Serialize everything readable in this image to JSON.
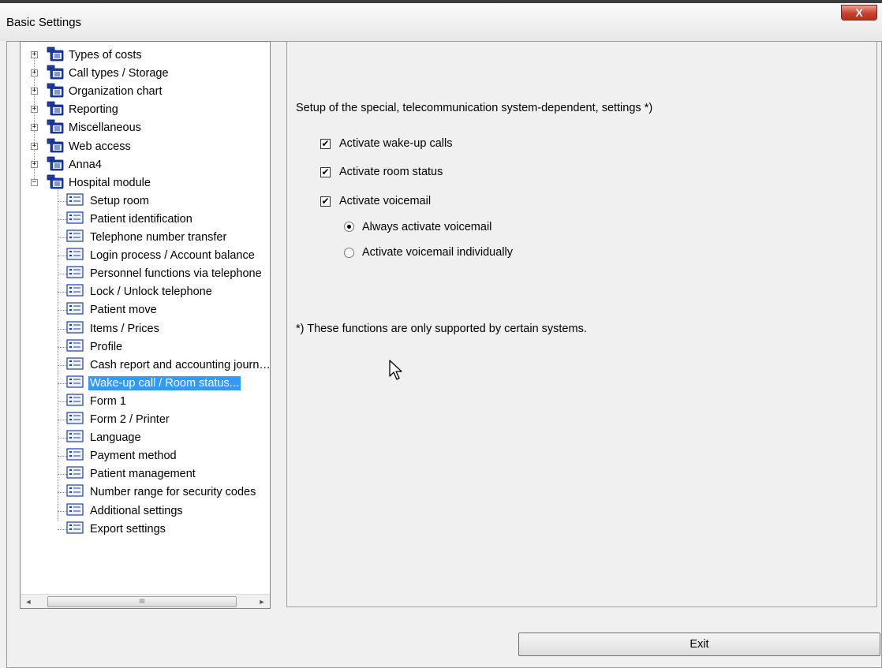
{
  "window": {
    "title": "Basic Settings",
    "close_glyph": "X"
  },
  "tree": {
    "top_items": [
      {
        "label": "Types of costs",
        "icon": "folder-tree-icon",
        "expanded": false
      },
      {
        "label": "Call types / Storage",
        "icon": "folder-tree-icon",
        "expanded": false
      },
      {
        "label": "Organization chart",
        "icon": "folder-tree-icon",
        "expanded": false
      },
      {
        "label": "Reporting",
        "icon": "folder-tree-icon",
        "expanded": false
      },
      {
        "label": "Miscellaneous",
        "icon": "folder-tree-icon",
        "expanded": false
      },
      {
        "label": "Web access",
        "icon": "folder-tree-icon",
        "expanded": false
      },
      {
        "label": "Anna4",
        "icon": "folder-tree-icon",
        "expanded": false
      },
      {
        "label": "Hospital module",
        "icon": "folder-tree-icon",
        "expanded": true
      }
    ],
    "children": [
      {
        "label": "Setup room"
      },
      {
        "label": "Patient identification"
      },
      {
        "label": "Telephone number transfer"
      },
      {
        "label": "Login process / Account balance"
      },
      {
        "label": "Personnel functions via telephone"
      },
      {
        "label": "Lock / Unlock telephone"
      },
      {
        "label": "Patient move"
      },
      {
        "label": "Items / Prices"
      },
      {
        "label": "Profile"
      },
      {
        "label": "Cash report and accounting journ…"
      },
      {
        "label": "Wake-up call / Room status...",
        "selected": true
      },
      {
        "label": "Form 1"
      },
      {
        "label": "Form 2 / Printer"
      },
      {
        "label": "Language"
      },
      {
        "label": "Payment method"
      },
      {
        "label": "Patient management"
      },
      {
        "label": "Number range for security codes"
      },
      {
        "label": "Additional settings"
      },
      {
        "label": "Export settings"
      }
    ],
    "scrollbar": {
      "left_arrow": "◄",
      "right_arrow": "►",
      "thumb_grip": "III"
    }
  },
  "panel": {
    "heading": "Setup of the special, telecommunication system-dependent, settings *)",
    "checkboxes": [
      {
        "label": "Activate wake-up calls",
        "checked": true
      },
      {
        "label": "Activate room status",
        "checked": true
      },
      {
        "label": "Activate voicemail",
        "checked": true
      }
    ],
    "radios": [
      {
        "label": "Always activate voicemail",
        "selected": true
      },
      {
        "label": "Activate voicemail individually",
        "selected": false
      }
    ],
    "footnote": "*) These functions are only supported by certain systems.",
    "check_glyph": "✔"
  },
  "footer": {
    "exit_label": "Exit"
  },
  "colors": {
    "selection": "#3399ff",
    "close_button": "#c7402c"
  }
}
